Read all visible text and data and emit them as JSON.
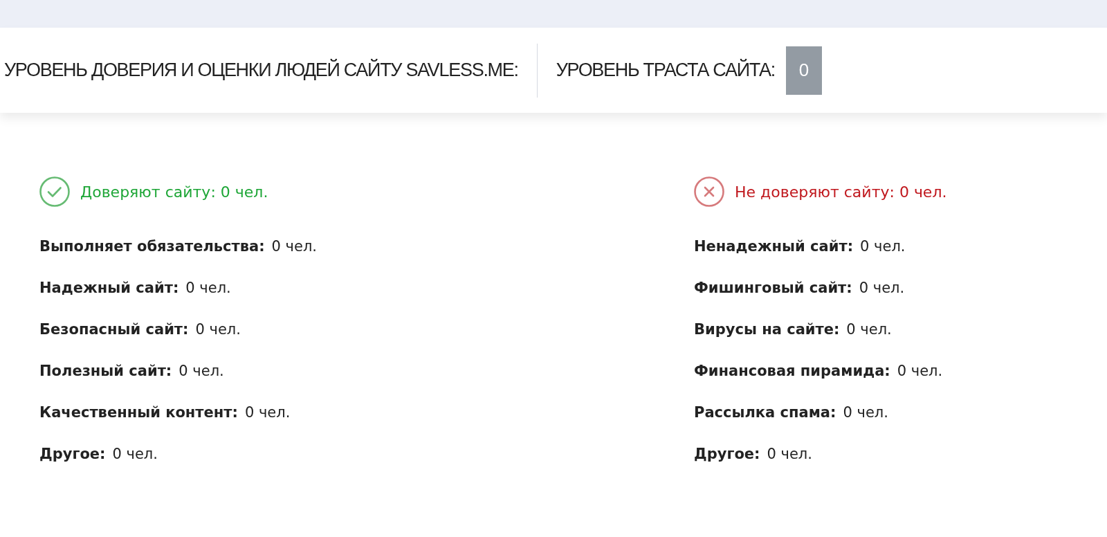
{
  "header": {
    "title": "УРОВЕНЬ ДОВЕРИЯ И ОЦЕНКИ ЛЮДЕЙ САЙТУ SAVLESS.ME:",
    "trust_label": "УРОВЕНЬ ТРАСТА САЙТА:",
    "trust_value": "0"
  },
  "groups": [
    {
      "kind": "positive",
      "heading": "Доверяют сайту: 0 чел.",
      "items": [
        {
          "label": "Выполняет обязательства:",
          "value": "0 чел."
        },
        {
          "label": "Надежный сайт:",
          "value": "0 чел."
        },
        {
          "label": "Безопасный сайт:",
          "value": "0 чел."
        },
        {
          "label": "Полезный сайт:",
          "value": "0 чел."
        },
        {
          "label": "Качественный контент:",
          "value": "0 чел."
        },
        {
          "label": "Другое:",
          "value": "0 чел."
        }
      ]
    },
    {
      "kind": "negative",
      "heading": "Не доверяют сайту: 0 чел.",
      "items": [
        {
          "label": "Ненадежный сайт:",
          "value": "0 чел."
        },
        {
          "label": "Фишинговый сайт:",
          "value": "0 чел."
        },
        {
          "label": "Вирусы на сайте:",
          "value": "0 чел."
        },
        {
          "label": "Финансовая пирамида:",
          "value": "0 чел."
        },
        {
          "label": "Рассылка спама:",
          "value": "0 чел."
        },
        {
          "label": "Другое:",
          "value": "0 чел."
        }
      ]
    }
  ]
}
